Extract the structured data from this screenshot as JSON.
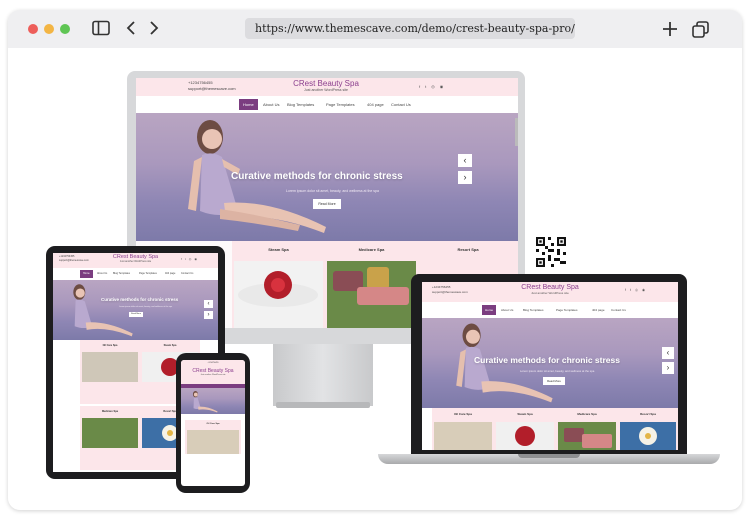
{
  "browser": {
    "url": "https://www.themescave.com/demo/crest-beauty-spa-pro/"
  },
  "site": {
    "name": "CRest Beauty Spa",
    "tagline": "Just another WordPress site",
    "phone": "+1234756455",
    "email": "support@themescave.com",
    "nav": [
      "Home",
      "About Us",
      "Blog Templates",
      "Page Templates",
      "404 page",
      "Contact Us"
    ],
    "hero_title": "Curative methods for chronic stress",
    "hero_sub": "Lorem ipsum dolor sit amet, beauty, and wellness at the spa",
    "hero_button": "Read More",
    "categories": [
      "Oil Care Spa",
      "Steam Spa",
      "Medicare Spa",
      "Resort Spa"
    ]
  },
  "colors": {
    "brand": "#8b3f8e",
    "nav_active": "#7b3d80",
    "header_bg": "#fce6ea",
    "hero_bg": "#a998bd"
  }
}
